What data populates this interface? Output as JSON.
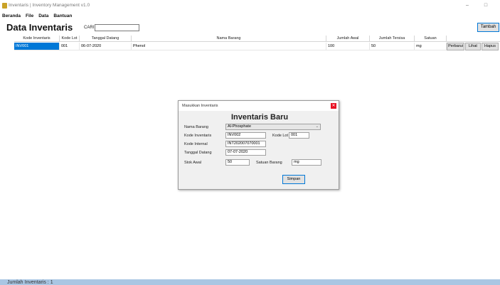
{
  "window": {
    "title": "Inventaris | Inventory Management v1.0",
    "minimize_glyph": "–",
    "maximize_glyph": "□"
  },
  "menu": {
    "items": [
      "Beranda",
      "File",
      "Data",
      "Bantuan"
    ]
  },
  "header": {
    "title": "Data Inventaris",
    "search_label": "CARI",
    "search_value": "",
    "add_button": "Tambah"
  },
  "table": {
    "columns": [
      "Kode Inventaris",
      "Kode Lot",
      "Tanggal Datang",
      "Nama Barang",
      "Jumlah Awal",
      "Jumlah Tersisa",
      "Satuan"
    ],
    "rows": [
      {
        "kode_inventaris": "INV001",
        "kode_lot": "001",
        "tanggal_datang": "06-07-2020",
        "nama_barang": "Phenol",
        "jumlah_awal": "100",
        "jumlah_tersisa": "50",
        "satuan": "mg",
        "actions": [
          "Perbarui",
          "Lihat",
          "Hapus"
        ]
      }
    ]
  },
  "status": {
    "text": "Jumlah Inventaris : 1"
  },
  "dialog": {
    "title": "Masukkan Inventaris",
    "close_glyph": "✕",
    "heading": "Inventaris Baru",
    "fields": {
      "nama_barang_label": "Nama Barang",
      "nama_barang_value": "Al-Phosphate",
      "kode_inventaris_label": "Kode Inventaris",
      "kode_inventaris_value": "INV002",
      "kode_lot_label": "Kode Lot",
      "kode_lot_value": "001",
      "kode_internal_label": "Kode Internal",
      "kode_internal_value": "INT202007070001",
      "tanggal_datang_label": "Tanggal Datang",
      "tanggal_datang_value": "07-07-2020",
      "stok_awal_label": "Stok Awal",
      "stok_awal_value": "50",
      "satuan_barang_label": "Satuan Barang",
      "satuan_barang_value": "mg"
    },
    "save_button": "Simpan"
  },
  "colors": {
    "accent": "#0078d7",
    "status_bar": "#a9c6e3",
    "close_red": "#e81123"
  }
}
